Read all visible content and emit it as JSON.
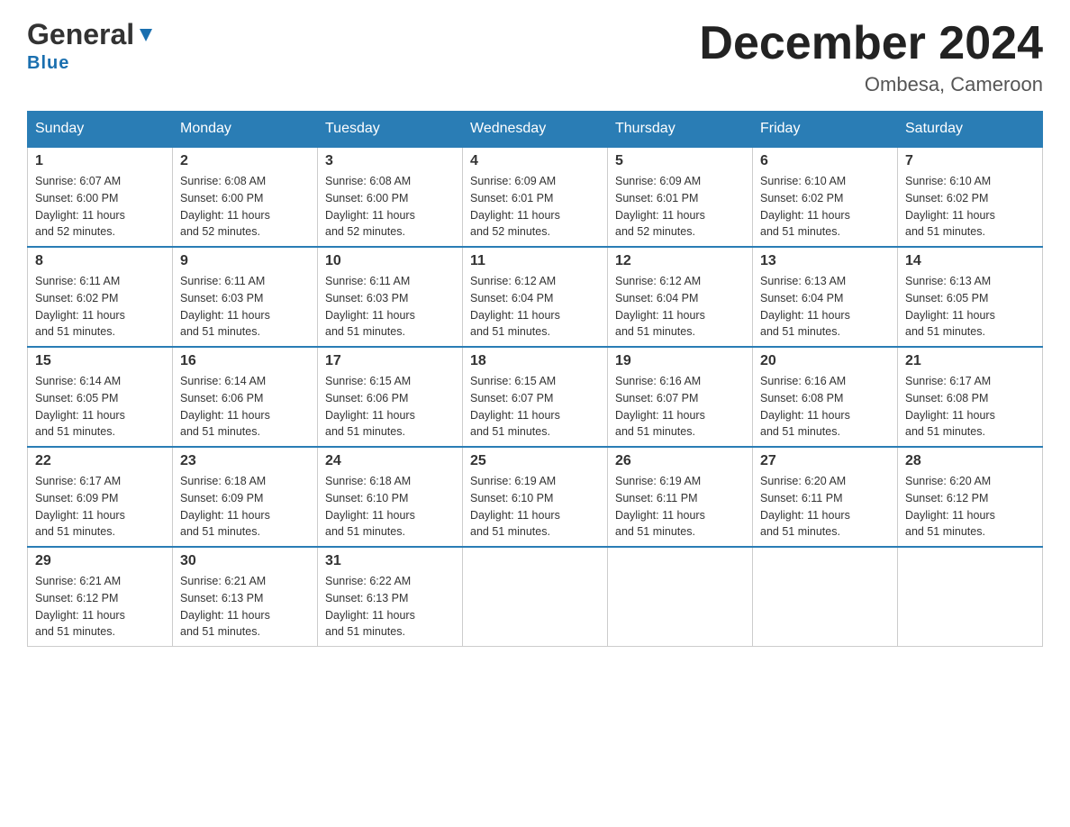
{
  "header": {
    "logo_general": "General",
    "logo_blue": "Blue",
    "title": "December 2024",
    "subtitle": "Ombesa, Cameroon"
  },
  "days_of_week": [
    "Sunday",
    "Monday",
    "Tuesday",
    "Wednesday",
    "Thursday",
    "Friday",
    "Saturday"
  ],
  "weeks": [
    [
      {
        "day": "1",
        "sunrise": "6:07 AM",
        "sunset": "6:00 PM",
        "daylight": "11 hours and 52 minutes."
      },
      {
        "day": "2",
        "sunrise": "6:08 AM",
        "sunset": "6:00 PM",
        "daylight": "11 hours and 52 minutes."
      },
      {
        "day": "3",
        "sunrise": "6:08 AM",
        "sunset": "6:00 PM",
        "daylight": "11 hours and 52 minutes."
      },
      {
        "day": "4",
        "sunrise": "6:09 AM",
        "sunset": "6:01 PM",
        "daylight": "11 hours and 52 minutes."
      },
      {
        "day": "5",
        "sunrise": "6:09 AM",
        "sunset": "6:01 PM",
        "daylight": "11 hours and 52 minutes."
      },
      {
        "day": "6",
        "sunrise": "6:10 AM",
        "sunset": "6:02 PM",
        "daylight": "11 hours and 51 minutes."
      },
      {
        "day": "7",
        "sunrise": "6:10 AM",
        "sunset": "6:02 PM",
        "daylight": "11 hours and 51 minutes."
      }
    ],
    [
      {
        "day": "8",
        "sunrise": "6:11 AM",
        "sunset": "6:02 PM",
        "daylight": "11 hours and 51 minutes."
      },
      {
        "day": "9",
        "sunrise": "6:11 AM",
        "sunset": "6:03 PM",
        "daylight": "11 hours and 51 minutes."
      },
      {
        "day": "10",
        "sunrise": "6:11 AM",
        "sunset": "6:03 PM",
        "daylight": "11 hours and 51 minutes."
      },
      {
        "day": "11",
        "sunrise": "6:12 AM",
        "sunset": "6:04 PM",
        "daylight": "11 hours and 51 minutes."
      },
      {
        "day": "12",
        "sunrise": "6:12 AM",
        "sunset": "6:04 PM",
        "daylight": "11 hours and 51 minutes."
      },
      {
        "day": "13",
        "sunrise": "6:13 AM",
        "sunset": "6:04 PM",
        "daylight": "11 hours and 51 minutes."
      },
      {
        "day": "14",
        "sunrise": "6:13 AM",
        "sunset": "6:05 PM",
        "daylight": "11 hours and 51 minutes."
      }
    ],
    [
      {
        "day": "15",
        "sunrise": "6:14 AM",
        "sunset": "6:05 PM",
        "daylight": "11 hours and 51 minutes."
      },
      {
        "day": "16",
        "sunrise": "6:14 AM",
        "sunset": "6:06 PM",
        "daylight": "11 hours and 51 minutes."
      },
      {
        "day": "17",
        "sunrise": "6:15 AM",
        "sunset": "6:06 PM",
        "daylight": "11 hours and 51 minutes."
      },
      {
        "day": "18",
        "sunrise": "6:15 AM",
        "sunset": "6:07 PM",
        "daylight": "11 hours and 51 minutes."
      },
      {
        "day": "19",
        "sunrise": "6:16 AM",
        "sunset": "6:07 PM",
        "daylight": "11 hours and 51 minutes."
      },
      {
        "day": "20",
        "sunrise": "6:16 AM",
        "sunset": "6:08 PM",
        "daylight": "11 hours and 51 minutes."
      },
      {
        "day": "21",
        "sunrise": "6:17 AM",
        "sunset": "6:08 PM",
        "daylight": "11 hours and 51 minutes."
      }
    ],
    [
      {
        "day": "22",
        "sunrise": "6:17 AM",
        "sunset": "6:09 PM",
        "daylight": "11 hours and 51 minutes."
      },
      {
        "day": "23",
        "sunrise": "6:18 AM",
        "sunset": "6:09 PM",
        "daylight": "11 hours and 51 minutes."
      },
      {
        "day": "24",
        "sunrise": "6:18 AM",
        "sunset": "6:10 PM",
        "daylight": "11 hours and 51 minutes."
      },
      {
        "day": "25",
        "sunrise": "6:19 AM",
        "sunset": "6:10 PM",
        "daylight": "11 hours and 51 minutes."
      },
      {
        "day": "26",
        "sunrise": "6:19 AM",
        "sunset": "6:11 PM",
        "daylight": "11 hours and 51 minutes."
      },
      {
        "day": "27",
        "sunrise": "6:20 AM",
        "sunset": "6:11 PM",
        "daylight": "11 hours and 51 minutes."
      },
      {
        "day": "28",
        "sunrise": "6:20 AM",
        "sunset": "6:12 PM",
        "daylight": "11 hours and 51 minutes."
      }
    ],
    [
      {
        "day": "29",
        "sunrise": "6:21 AM",
        "sunset": "6:12 PM",
        "daylight": "11 hours and 51 minutes."
      },
      {
        "day": "30",
        "sunrise": "6:21 AM",
        "sunset": "6:13 PM",
        "daylight": "11 hours and 51 minutes."
      },
      {
        "day": "31",
        "sunrise": "6:22 AM",
        "sunset": "6:13 PM",
        "daylight": "11 hours and 51 minutes."
      },
      null,
      null,
      null,
      null
    ]
  ],
  "labels": {
    "sunrise": "Sunrise:",
    "sunset": "Sunset:",
    "daylight": "Daylight:"
  }
}
